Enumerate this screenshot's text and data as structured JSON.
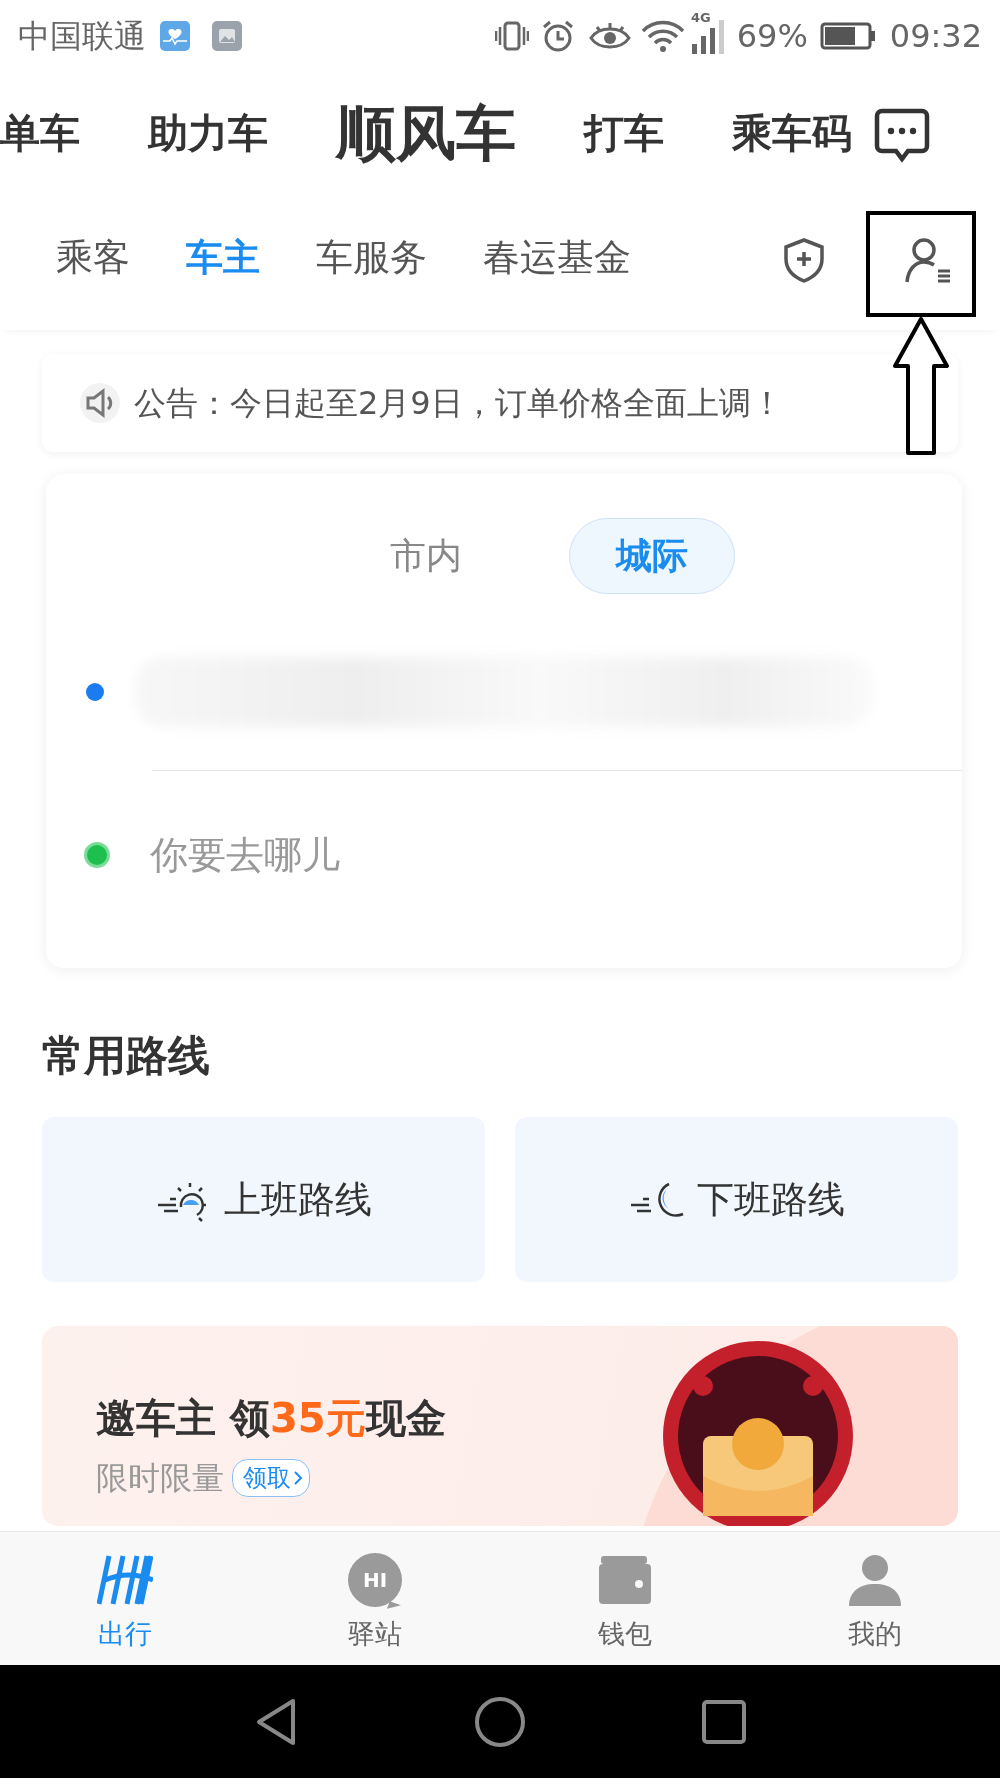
{
  "status_bar": {
    "carrier": "中国联通",
    "network": "4G",
    "battery": "69%",
    "time": "09:32"
  },
  "main_tabs": [
    {
      "label": "单车",
      "selected": false
    },
    {
      "label": "助力车",
      "selected": false
    },
    {
      "label": "顺风车",
      "selected": true
    },
    {
      "label": "打车",
      "selected": false
    },
    {
      "label": "乘车码",
      "selected": false
    }
  ],
  "sub_tabs": [
    {
      "label": "乘客",
      "selected": false
    },
    {
      "label": "车主",
      "selected": true
    },
    {
      "label": "车服务",
      "selected": false
    },
    {
      "label": "春运基金",
      "selected": false
    }
  ],
  "notice": {
    "text": "公告：今日起至2月9日，订单价格全面上调！"
  },
  "trip_card": {
    "modes": [
      {
        "label": "市内",
        "selected": false
      },
      {
        "label": "城际",
        "selected": true
      }
    ],
    "destination": {
      "placeholder": "你要去哪儿"
    }
  },
  "common_routes": {
    "title": "常用路线",
    "routes": [
      {
        "kind": "sun",
        "label": "上班路线"
      },
      {
        "kind": "moon",
        "label": "下班路线"
      }
    ]
  },
  "promo": {
    "title_start": "邀车主 领",
    "highlight": "35元",
    "title_end": "现金",
    "subtitle": "限时限量",
    "button": "领取"
  },
  "bottom_nav": [
    {
      "kind": "logo",
      "label": "出行",
      "selected": true
    },
    {
      "kind": "chat",
      "label": "驿站",
      "icon_text": "HI",
      "selected": false
    },
    {
      "kind": "wallet",
      "label": "钱包",
      "selected": false
    },
    {
      "kind": "person",
      "label": "我的",
      "selected": false
    }
  ]
}
